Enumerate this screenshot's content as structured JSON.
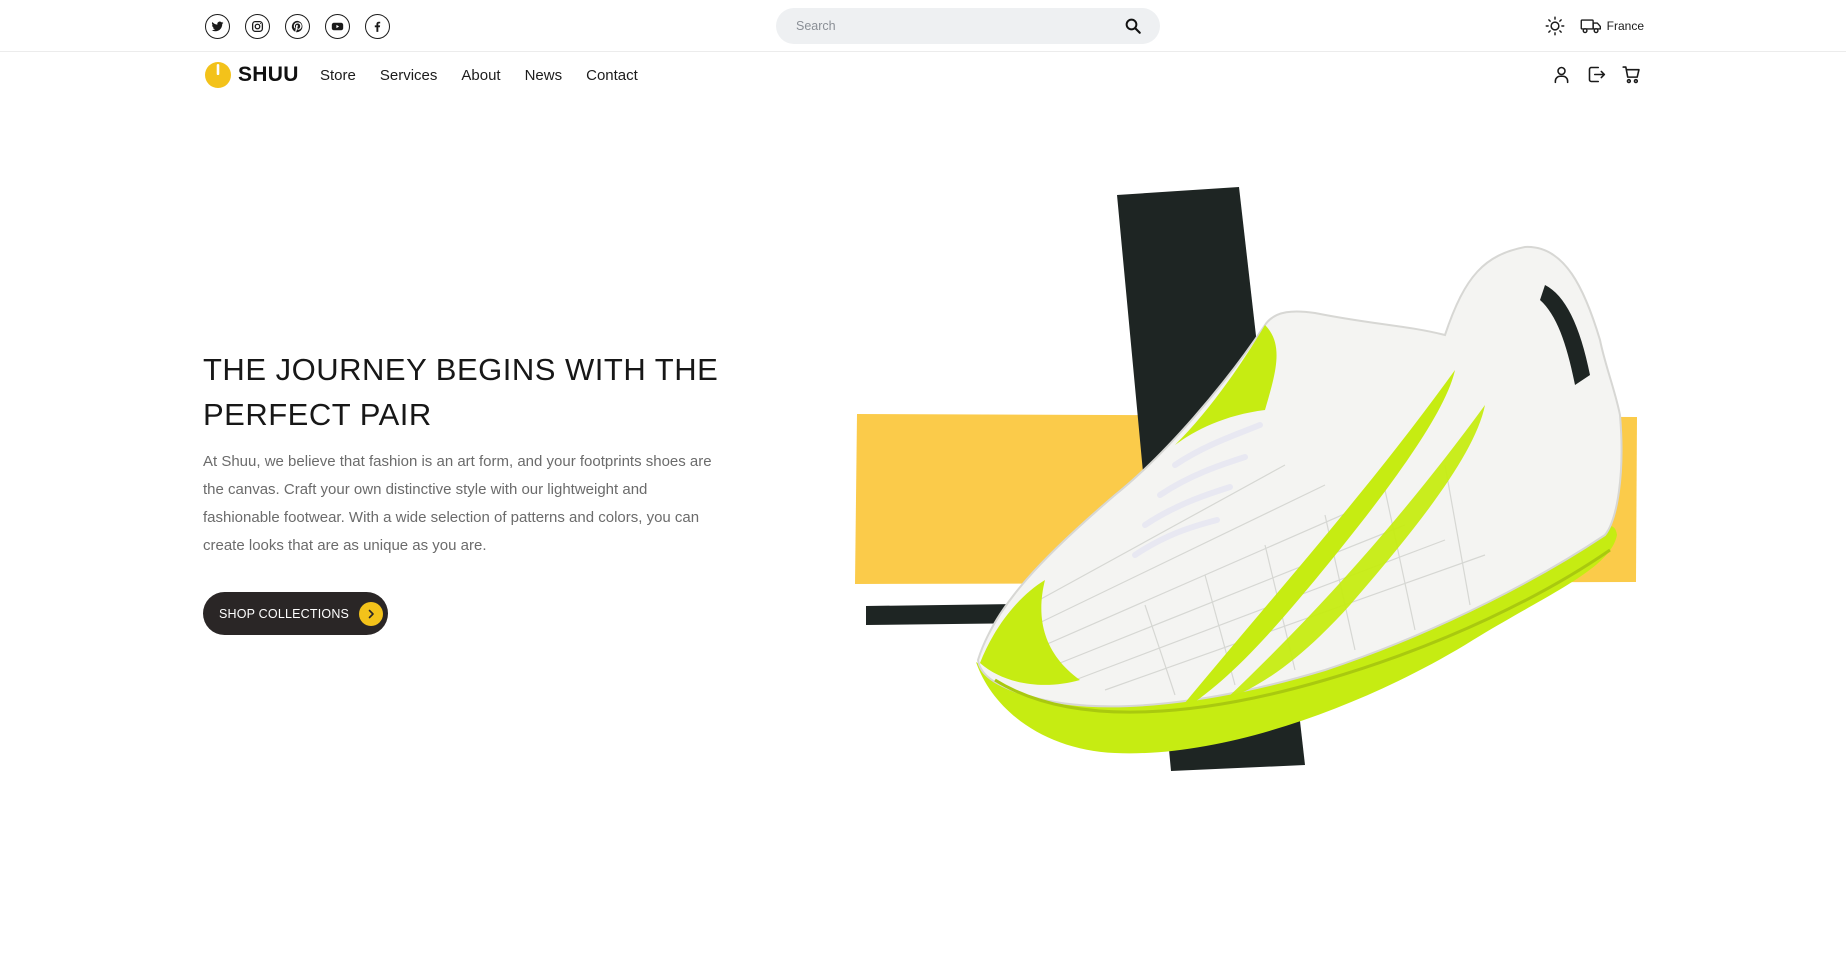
{
  "header": {
    "socials": [
      {
        "name": "twitter-icon"
      },
      {
        "name": "instagram-icon"
      },
      {
        "name": "pinterest-icon"
      },
      {
        "name": "youtube-icon"
      },
      {
        "name": "facebook-icon"
      }
    ],
    "search": {
      "placeholder": "Search",
      "value": "",
      "icon": "search-icon"
    },
    "theme_icon": "sun-icon",
    "shipping_icon": "truck-icon",
    "region": "France"
  },
  "nav": {
    "brand": "SHUU",
    "brand_color": "#f3c21a",
    "links": [
      "Store",
      "Services",
      "About",
      "News",
      "Contact"
    ],
    "icons": [
      "user-icon",
      "logout-icon",
      "cart-icon"
    ]
  },
  "hero": {
    "title": "THE JOURNEY BEGINS WITH THE PERFECT PAIR",
    "description": "At Shuu, we believe that fashion is an art form, and your footprints shoes are the canvas. Craft your own distinctive style with our lightweight and fashionable footwear. With a wide selection of patterns and colors, you can create looks that are as unique as you are.",
    "cta_label": "SHOP COLLECTIONS",
    "cta_icon": "chevron-right-icon",
    "colors": {
      "accent": "#f3c21a",
      "yellow_panel": "#fbcb4a",
      "dark_strip": "#1e2523",
      "shoe_green": "#c6ec12"
    }
  }
}
